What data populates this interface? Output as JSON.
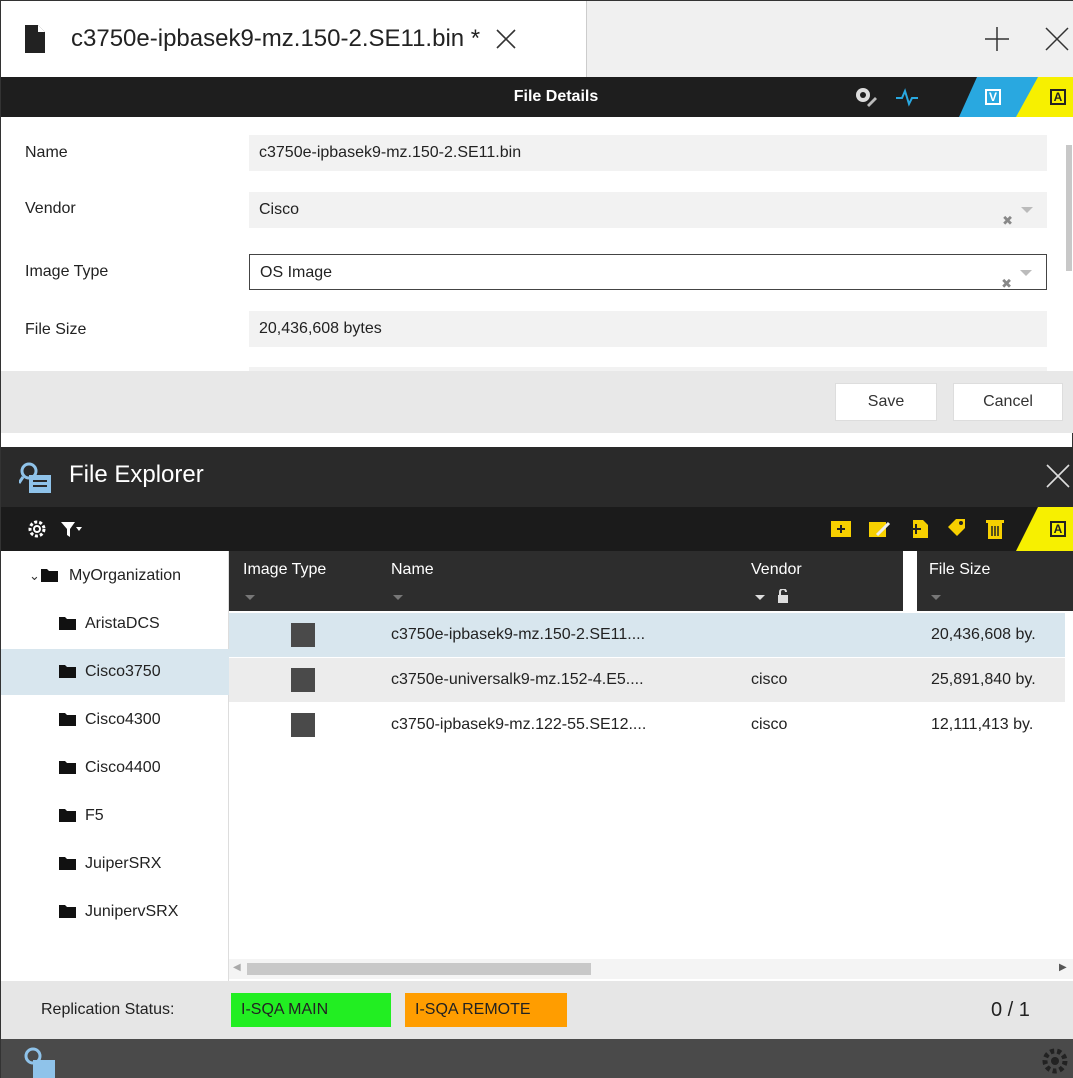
{
  "tab": {
    "title": "c3750e-ipbasek9-mz.150-2.SE11.bin *"
  },
  "details": {
    "header": "File Details",
    "badges": {
      "v": "V",
      "a": "A"
    },
    "fields": {
      "name_label": "Name",
      "name_value": "c3750e-ipbasek9-mz.150-2.SE11.bin",
      "vendor_label": "Vendor",
      "vendor_value": "Cisco",
      "image_type_label": "Image Type",
      "image_type_value": "OS Image",
      "file_size_label": "File Size",
      "file_size_value": "20,436,608 bytes"
    },
    "save_label": "Save",
    "cancel_label": "Cancel"
  },
  "explorer": {
    "title": "File Explorer",
    "badge": "A",
    "tree": [
      {
        "label": "MyOrganization",
        "root": true
      },
      {
        "label": "AristaDCS"
      },
      {
        "label": "Cisco3750",
        "selected": true
      },
      {
        "label": "Cisco4300"
      },
      {
        "label": "Cisco4400"
      },
      {
        "label": "F5"
      },
      {
        "label": "JuiperSRX"
      },
      {
        "label": "JunipervSRX"
      }
    ],
    "columns": {
      "image_type": "Image Type",
      "name": "Name",
      "vendor": "Vendor",
      "file_size": "File Size"
    },
    "rows": [
      {
        "name": "c3750e-ipbasek9-mz.150-2.SE11....",
        "vendor": "",
        "size": "20,436,608 by."
      },
      {
        "name": "c3750e-universalk9-mz.152-4.E5....",
        "vendor": "cisco",
        "size": "25,891,840 by."
      },
      {
        "name": "c3750-ipbasek9-mz.122-55.SE12....",
        "vendor": "cisco",
        "size": "12,111,413 by."
      }
    ],
    "status": {
      "label": "Replication Status:",
      "chips": [
        "I-SQA MAIN",
        "I-SQA REMOTE"
      ],
      "count": "0 / 1"
    }
  },
  "colors": {
    "accent_blue": "#29a8e0",
    "accent_yellow": "#f7f000",
    "status_green": "#22ee22",
    "status_orange": "#ff9d00",
    "selection": "#d8e6ee"
  }
}
